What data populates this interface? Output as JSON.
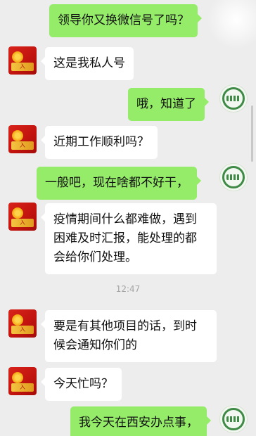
{
  "chat": {
    "messages": [
      {
        "side": "out",
        "text": "领导你又换微信号了吗？"
      },
      {
        "side": "in",
        "text": "这是我私人号"
      },
      {
        "side": "out",
        "text": "哦，知道了"
      },
      {
        "side": "in",
        "text": "近期工作顺利吗？"
      },
      {
        "side": "out",
        "text": "一般吧，现在啥都不好干，"
      },
      {
        "side": "in",
        "line1": "疫情期间什么都难做，遇到",
        "line2": "困难及时汇报，能处理的都",
        "line3": "会给你们处理。"
      },
      {
        "side": "in",
        "line1": "要是有其他项目的话，到时",
        "line2": "候会通知你们的"
      },
      {
        "side": "in",
        "text": "今天忙吗？"
      },
      {
        "side": "out",
        "text": "我今天在西安办点事，"
      }
    ],
    "timestamp": "12:47",
    "avatar_badge_text": "入"
  },
  "colors": {
    "outgoing_bubble": "#95ec69",
    "incoming_bubble": "#ffffff",
    "background": "#ededed"
  }
}
